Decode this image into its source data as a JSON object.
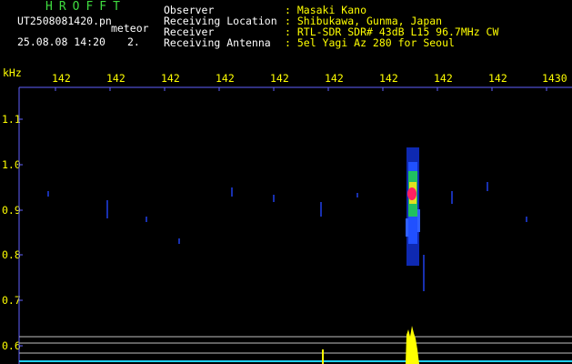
{
  "header": {
    "app_title": "HROFFT",
    "file_name": "UT2508081420.pn",
    "tag": "meteor",
    "datetime": "25.08.08 14:20",
    "counter": "2."
  },
  "station_info": {
    "labels": "Observer\nReceiving Location\nReceiver\nReceiving Antenna",
    "values": ": Masaki Kano\n: Shibukawa, Gunma, Japan\n: RTL-SDR SDR# 43dB L15 96.7MHz CW\n: 5el Yagi Az 280 for Seoul"
  },
  "axes": {
    "y_unit": "kHz",
    "y_ticks": [
      "1.1",
      "1.0",
      "0.9",
      "0.8",
      "0.7",
      "0.6"
    ],
    "x_ticks": [
      "142",
      "142",
      "142",
      "142",
      "142",
      "142",
      "142",
      "142",
      "142",
      "1430"
    ]
  },
  "colors": {
    "background": "#000000",
    "header_text": "#3fdc3f",
    "label_text": "#ffffff",
    "value_text": "#ffff00",
    "echo_hot": "#ff2060",
    "echo_mid": "#20c060",
    "echo_low": "#2040ff"
  }
}
